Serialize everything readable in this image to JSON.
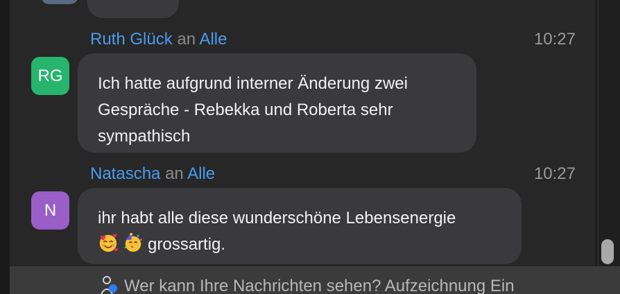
{
  "messages": [
    {
      "sender": "Ruth Glück",
      "connector": "an",
      "recipient": "Alle",
      "time": "10:27",
      "avatar_initials": "RG",
      "avatar_color": "#27b46c",
      "lines": [
        "Ich hatte aufgrund interner Änderung zwei",
        "Gespräche - Rebekka und Roberta sehr",
        "sympathisch"
      ]
    },
    {
      "sender": "Natascha",
      "connector": "an",
      "recipient": "Alle",
      "time": "10:27",
      "avatar_initials": "N",
      "avatar_color": "#9a5ec8",
      "lines": [
        "ihr habt alle diese wunderschöne Lebensenergie",
        "grossartig."
      ],
      "emojis": [
        "smiling-face-with-hearts-icon",
        "partying-face-icon"
      ]
    }
  ],
  "footer": {
    "text": "Wer kann Ihre Nachrichten sehen? Aufzeichnung Ein",
    "icon": "person-visibility-icon"
  },
  "colors": {
    "name_link": "#4a9bf0",
    "bubble": "#3a3a3c",
    "panel": "#272727",
    "footer_bar": "#3b3b3b"
  }
}
